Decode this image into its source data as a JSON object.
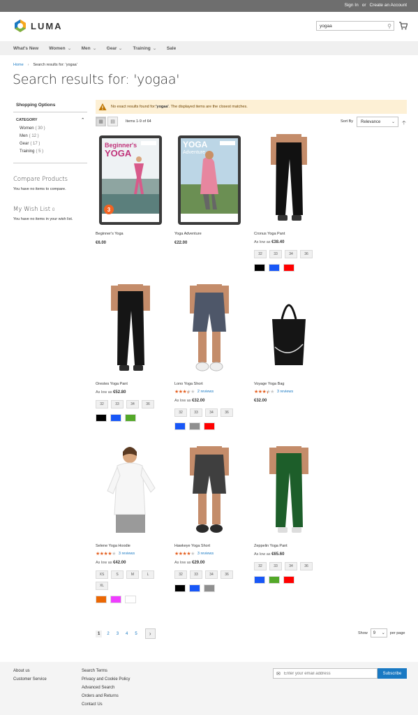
{
  "top_links": {
    "sign_in": "Sign In",
    "or": "or",
    "create_account": "Create an Account"
  },
  "brand": {
    "name": "LUMA"
  },
  "search": {
    "value": "yogaa"
  },
  "nav": [
    "What's New",
    "Women",
    "Men",
    "Gear",
    "Training",
    "Sale"
  ],
  "breadcrumb": {
    "home": "Home",
    "current": "Search results for: 'yogaa'"
  },
  "page_title": "Search results for: 'yogaa'",
  "sidebar": {
    "shopping_options": "Shopping Options",
    "category_title": "CATEGORY",
    "categories": [
      {
        "label": "Women",
        "count": "( 30 )"
      },
      {
        "label": "Men",
        "count": "( 12 )"
      },
      {
        "label": "Gear",
        "count": "( 17 )"
      },
      {
        "label": "Training",
        "count": "( 5 )"
      }
    ],
    "compare_title": "Compare Products",
    "compare_text": "You have no items to compare.",
    "wishlist_title": "My Wish List",
    "wishlist_count": "0",
    "wishlist_text": "You have no items in your wish list."
  },
  "notice": {
    "prefix": "No exact results found for: ",
    "term": "'yogaa'",
    "suffix": ". The displayed items are the closest matches."
  },
  "toolbar": {
    "amount": "Items 1-9 of 64",
    "sort_label": "Sort By",
    "sort_value": "Relevance"
  },
  "products": [
    {
      "name": "Beginner's Yoga",
      "price": "€6.00"
    },
    {
      "name": "Yoga Adventure",
      "price": "€22.00"
    },
    {
      "name": "Cronus Yoga Pant",
      "price_prefix": "As low as",
      "price": "€38.40",
      "sizes": [
        "32",
        "33",
        "34",
        "36"
      ],
      "colors": [
        "#000000",
        "#1857f7",
        "#ff0000"
      ]
    },
    {
      "name": "Orestes Yoga Pant",
      "price_prefix": "As low as",
      "price": "€52.80",
      "sizes": [
        "32",
        "33",
        "34",
        "36"
      ],
      "colors": [
        "#000000",
        "#1857f7",
        "#53a828"
      ]
    },
    {
      "name": "Lono Yoga Short",
      "rating": 3.5,
      "reviews": "2 reviews",
      "price_prefix": "As low as",
      "price": "€32.00",
      "sizes": [
        "32",
        "33",
        "34",
        "36"
      ],
      "colors": [
        "#1857f7",
        "#8f8f8f",
        "#ff0000"
      ]
    },
    {
      "name": "Voyage Yoga Bag",
      "rating": 3.5,
      "reviews": "3 reviews",
      "price": "€32.00"
    },
    {
      "name": "Selene Yoga Hoodie",
      "rating": 4,
      "reviews": "3 reviews",
      "price_prefix": "As low as",
      "price": "€42.00",
      "sizes": [
        "XS",
        "S",
        "M",
        "L",
        "XL"
      ],
      "colors": [
        "#eb6703",
        "#ef3dff",
        "#ffffff"
      ]
    },
    {
      "name": "Hawkeye Yoga Short",
      "rating": 4,
      "reviews": "3 reviews",
      "price_prefix": "As low as",
      "price": "€29.00",
      "sizes": [
        "32",
        "33",
        "34",
        "36"
      ],
      "colors": [
        "#000000",
        "#1857f7",
        "#8f8f8f"
      ]
    },
    {
      "name": "Zeppelin Yoga Pant",
      "price_prefix": "As low as",
      "price": "€65.60",
      "sizes": [
        "32",
        "33",
        "34",
        "36"
      ],
      "colors": [
        "#1857f7",
        "#53a828",
        "#ff0000"
      ]
    }
  ],
  "dvd": {
    "beginners": {
      "title_top": "Beginner's",
      "title_big": "YOGA",
      "badge": "3"
    },
    "adventure": {
      "title_big": "YOGA",
      "title_small": "Adventure"
    }
  },
  "pager": {
    "pages": [
      "1",
      "2",
      "3",
      "4",
      "5"
    ],
    "current": "1"
  },
  "limiter": {
    "label": "Show",
    "value": "9",
    "suffix": "per page"
  },
  "footer": {
    "col1": [
      "About us",
      "Customer Service"
    ],
    "col2": [
      "Search Terms",
      "Privacy and Cookie Policy",
      "Advanced Search",
      "Orders and Returns",
      "Contact Us"
    ],
    "newsletter_placeholder": "Enter your email address",
    "subscribe": "Subscribe"
  }
}
